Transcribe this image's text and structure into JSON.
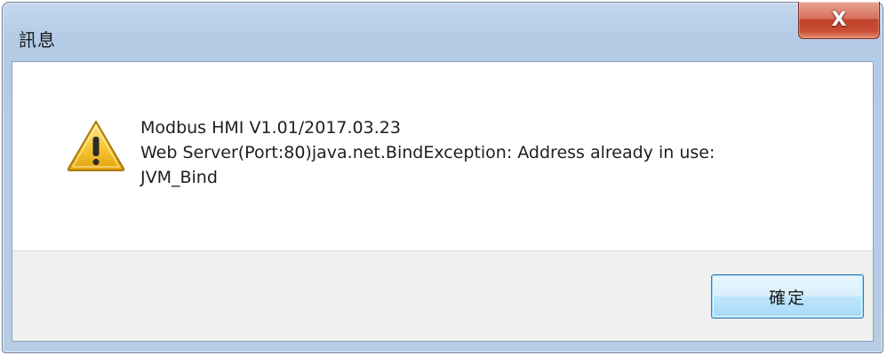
{
  "window": {
    "title": "訊息"
  },
  "titlebar": {
    "close_icon": "close-icon",
    "close_glyph": "X"
  },
  "dialog": {
    "icon": "warning-icon",
    "message_lines": [
      "Modbus HMI V1.01/2017.03.23",
      "Web Server(Port:80)java.net.BindException: Address already in use:",
      "JVM_Bind"
    ]
  },
  "buttons": {
    "ok_label": "確定"
  },
  "colors": {
    "client_bg": "#ffffff",
    "button_area_bg": "#f0f0f0",
    "frame_bg": "#b9cfe8",
    "close_button_red": "#c94e35",
    "warning_yellow": "#f6c533"
  }
}
